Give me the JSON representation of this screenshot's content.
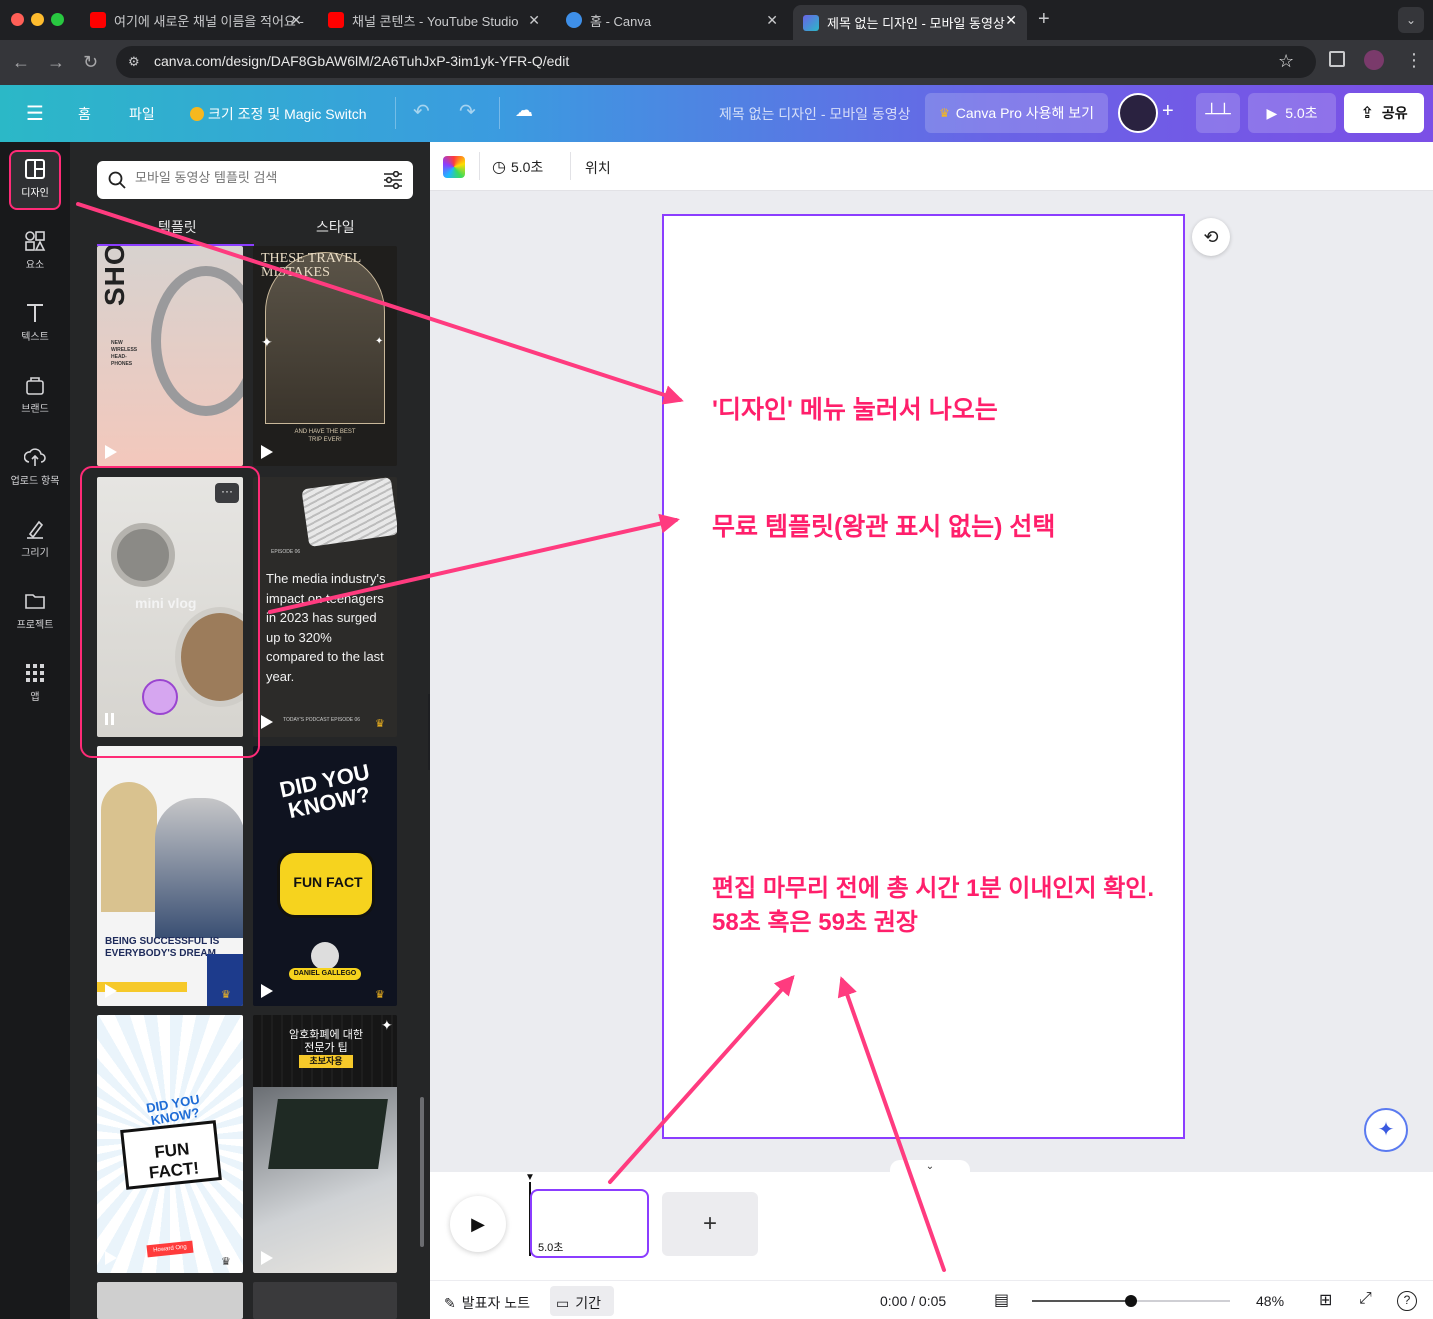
{
  "browser": {
    "tabs": [
      {
        "label": "여기에 새로운 채널 이름을 적어요 -",
        "icon": "youtube-icon"
      },
      {
        "label": "채널 콘텐츠 - YouTube Studio",
        "icon": "youtube-icon"
      },
      {
        "label": "홈 - Canva",
        "icon": "canva-icon"
      },
      {
        "label": "제목 없는 디자인 - 모바일 동영상",
        "icon": "canva-video-icon"
      }
    ],
    "url": "canva.com/design/DAF8GbAW6lM/2A6TuhJxP-3im1yk-YFR-Q/edit"
  },
  "topbar": {
    "menu_home": "홈",
    "menu_file": "파일",
    "magic_switch": "크기 조정 및 Magic Switch",
    "design_title": "제목 없는 디자인 - 모바일 동영상",
    "pro_cta": "Canva Pro 사용해 보기",
    "play_duration": "5.0초",
    "share": "공유"
  },
  "rail": [
    {
      "label": "디자인",
      "icon": "design-icon"
    },
    {
      "label": "요소",
      "icon": "elements-icon"
    },
    {
      "label": "텍스트",
      "icon": "text-icon"
    },
    {
      "label": "브랜드",
      "icon": "brand-icon"
    },
    {
      "label": "업로드 항목",
      "icon": "upload-icon"
    },
    {
      "label": "그리기",
      "icon": "draw-icon"
    },
    {
      "label": "프로젝트",
      "icon": "folder-icon"
    },
    {
      "label": "앱",
      "icon": "apps-icon"
    }
  ],
  "panel": {
    "search_placeholder": "모바일 동영상 템플릿 검색",
    "tab_templates": "템플릿",
    "tab_styles": "스타일",
    "thumbs": {
      "t1_brand": "SHODW",
      "t1_sub": "NEW WIRELESS HEAD-PHONES",
      "t2_title": "THESE TRAVEL MISTAKES",
      "t2_sub": "AND HAVE THE BEST TRIP EVER!",
      "t3_title": "mini vlog",
      "t4_body": "The media industry's impact on teenagers in 2023 has surged up to 320% compared to the last year.",
      "t4_episode": "EPISODE 06",
      "t4_footer": "TODAY'S PODCAST EPISODE 06",
      "t5_text": "BEING SUCCESSFUL IS EVERYBODY'S DREAM",
      "t6_title": "DID YOU KNOW?",
      "t6_badge": "FUN FACT",
      "t6_name": "DANIEL GALLEGO",
      "t7_title": "DID YOU KNOW?",
      "t7_badge": "FUN FACT!",
      "t7_tag": "Howard Ong",
      "t8_title": "암호화폐에 대한 전문가 팁",
      "t8_sub": "초보자용"
    }
  },
  "toolbar": {
    "duration": "5.0초",
    "position": "위치"
  },
  "annotations": {
    "a1": "'디자인' 메뉴 눌러서 나오는",
    "a2": "무료 템플릿(왕관 표시 없는) 선택",
    "a3_line1": "편집 마무리 전에 총 시간 1분 이내인지 확인.",
    "a3_line2": "58초 혹은 59초 권장"
  },
  "timeline": {
    "clip_duration": "5.0초"
  },
  "footer": {
    "notes": "발표자 노트",
    "duration": "기간",
    "time": "0:00 / 0:05",
    "zoom": "48%",
    "zoom_level": 0.48
  },
  "colors": {
    "accent": "#8b3dff",
    "annotation": "#ff1f6b"
  }
}
